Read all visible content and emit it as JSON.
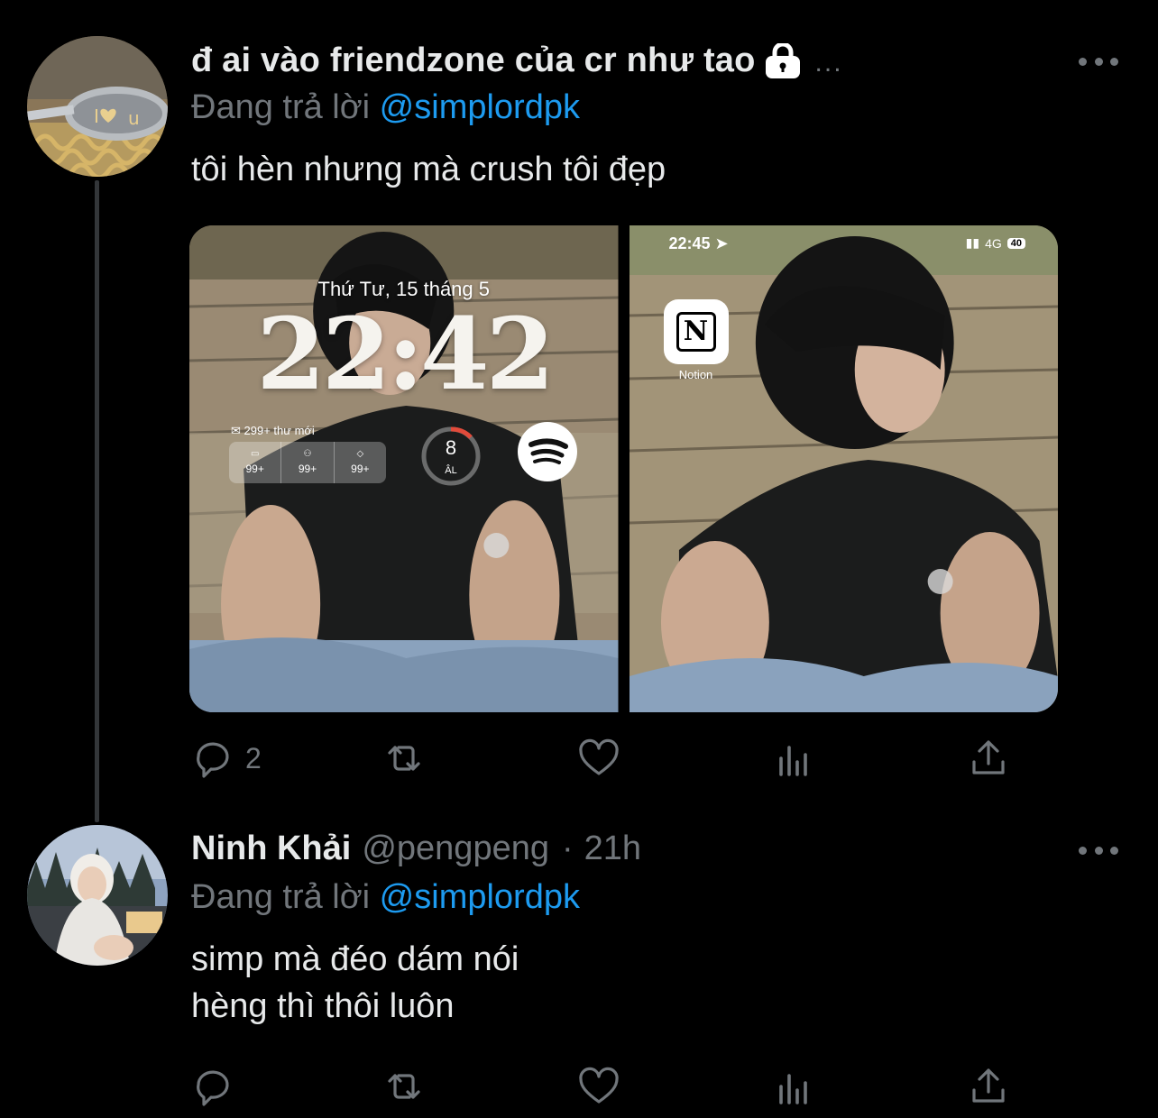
{
  "thread": {
    "tweet1": {
      "display_name": "đ ai vào friendzone của cr như tao",
      "name_trail": "...",
      "reply_prefix": "Đang trả lời",
      "reply_mention": "@simplordpk",
      "text": "tôi hèn nhưng mà crush tôi đẹp",
      "media": {
        "image1": {
          "lock_date": "Thứ Tư, 15 tháng 5",
          "lock_time": "22:42",
          "mail_label": "299+ thư mới",
          "mail_counts": [
            "99+",
            "99+",
            "99+"
          ],
          "moon_number": "8",
          "moon_sub": "ÂL"
        },
        "image2": {
          "status_time": "22:45",
          "network": "4G",
          "battery": "40",
          "app_label": "Notion"
        }
      },
      "actions": {
        "reply_count": "2"
      }
    },
    "tweet2": {
      "display_name": "Ninh Khải",
      "handle": "@pengpeng",
      "separator": "·",
      "time": "21h",
      "reply_prefix": "Đang trả lời",
      "reply_mention": "@simplordpk",
      "text": "simp mà đéo dám nói\nhèng thì thôi luôn",
      "actions": {
        "reply_count": ""
      }
    }
  },
  "icons": [
    "lock-icon",
    "more-icon",
    "reply-icon",
    "retweet-icon",
    "like-icon",
    "views-icon",
    "share-icon",
    "spotify-icon",
    "notion-icon",
    "gmail-icon",
    "location-arrow-icon"
  ],
  "colors": {
    "background": "#000000",
    "text": "#e7e9ea",
    "secondary": "#71767b",
    "mention": "#1d9bf0"
  }
}
